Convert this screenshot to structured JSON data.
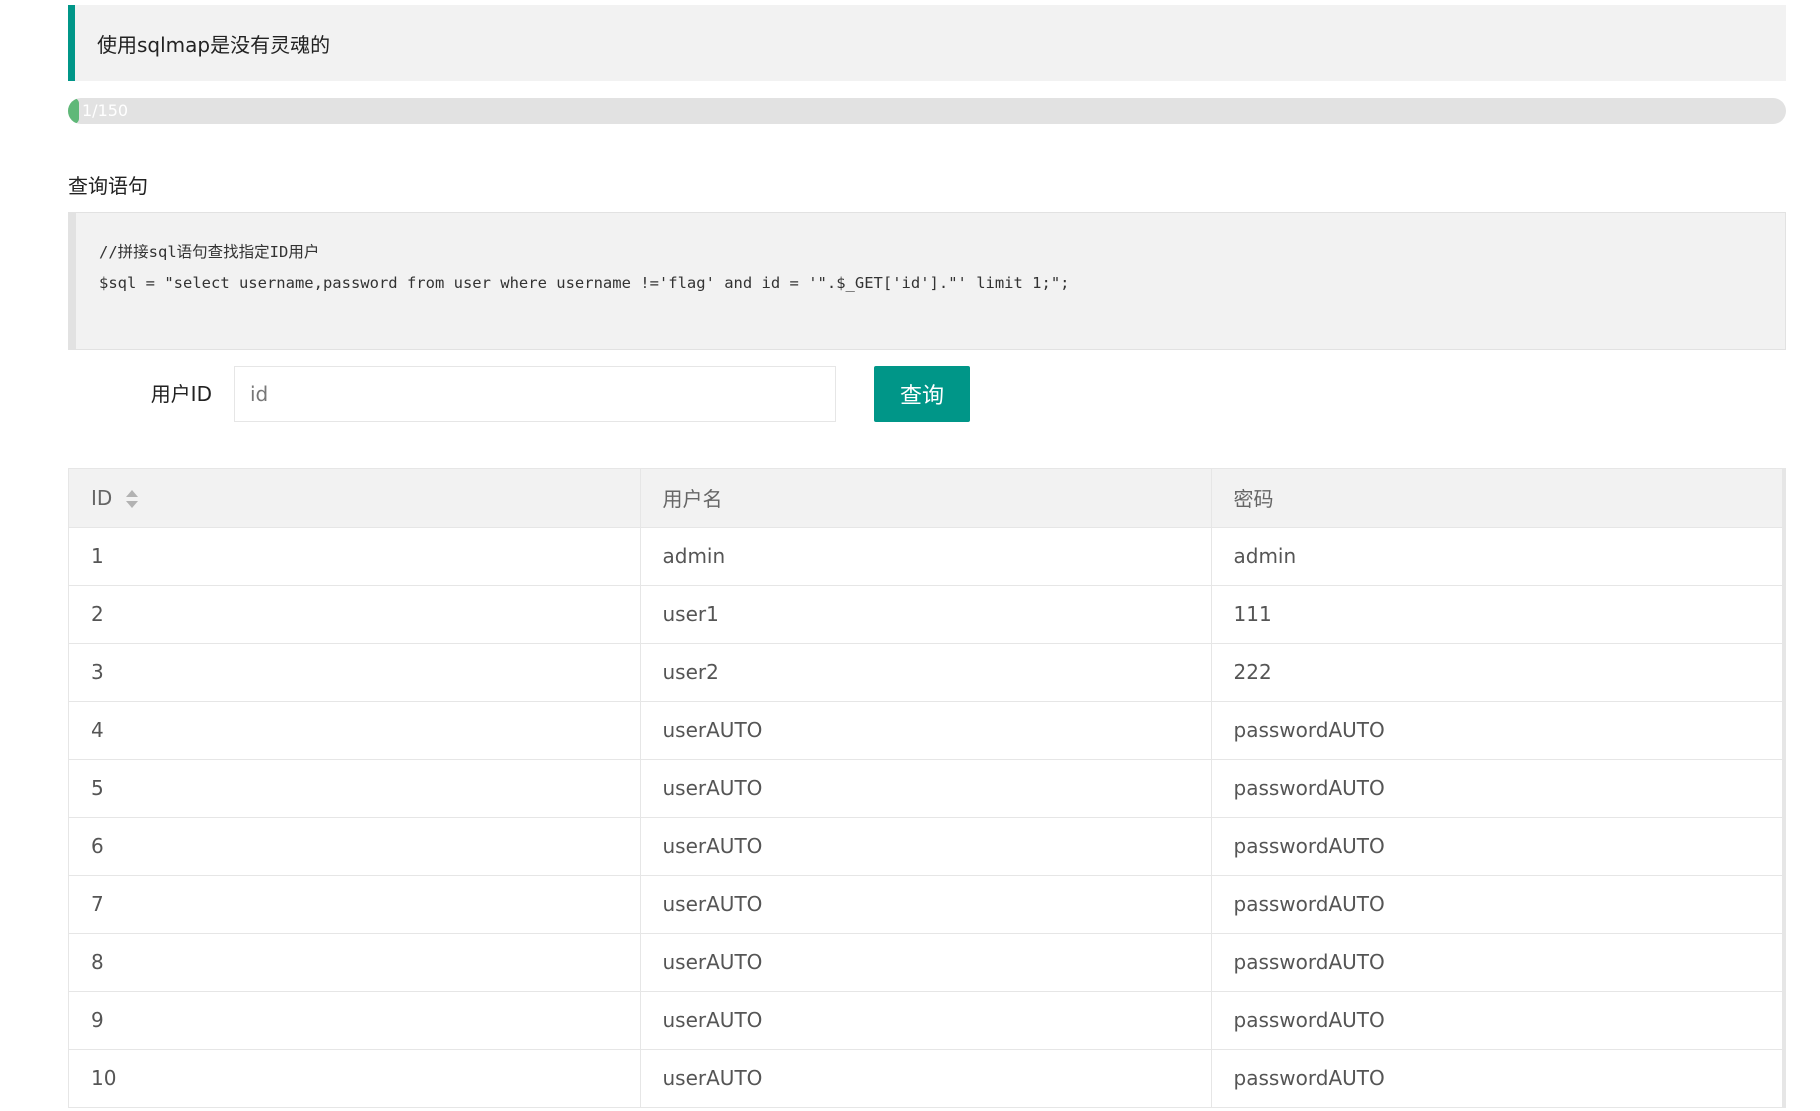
{
  "challenge": {
    "quote": "使用sqlmap是没有灵魂的"
  },
  "progress": {
    "text": "1/150",
    "current": 1,
    "total": 150
  },
  "query_section": {
    "title": "查询语句",
    "code_lines": [
      "//拼接sql语句查找指定ID用户",
      "$sql = \"select username,password from user where username !='flag' and id = '\".$_GET['id'].\"' limit 1;\";"
    ]
  },
  "form": {
    "label": "用户ID",
    "input_value": "",
    "input_placeholder": "id",
    "submit_label": "查询"
  },
  "table": {
    "columns": [
      "ID",
      "用户名",
      "密码"
    ],
    "rows": [
      [
        "1",
        "admin",
        "admin"
      ],
      [
        "2",
        "user1",
        "111"
      ],
      [
        "3",
        "user2",
        "222"
      ],
      [
        "4",
        "userAUTO",
        "passwordAUTO"
      ],
      [
        "5",
        "userAUTO",
        "passwordAUTO"
      ],
      [
        "6",
        "userAUTO",
        "passwordAUTO"
      ],
      [
        "7",
        "userAUTO",
        "passwordAUTO"
      ],
      [
        "8",
        "userAUTO",
        "passwordAUTO"
      ],
      [
        "9",
        "userAUTO",
        "passwordAUTO"
      ],
      [
        "10",
        "userAUTO",
        "passwordAUTO"
      ]
    ]
  },
  "icons": {
    "sort": "sort-icon"
  },
  "colors": {
    "accent": "#009688",
    "progress": "#5fb878"
  }
}
